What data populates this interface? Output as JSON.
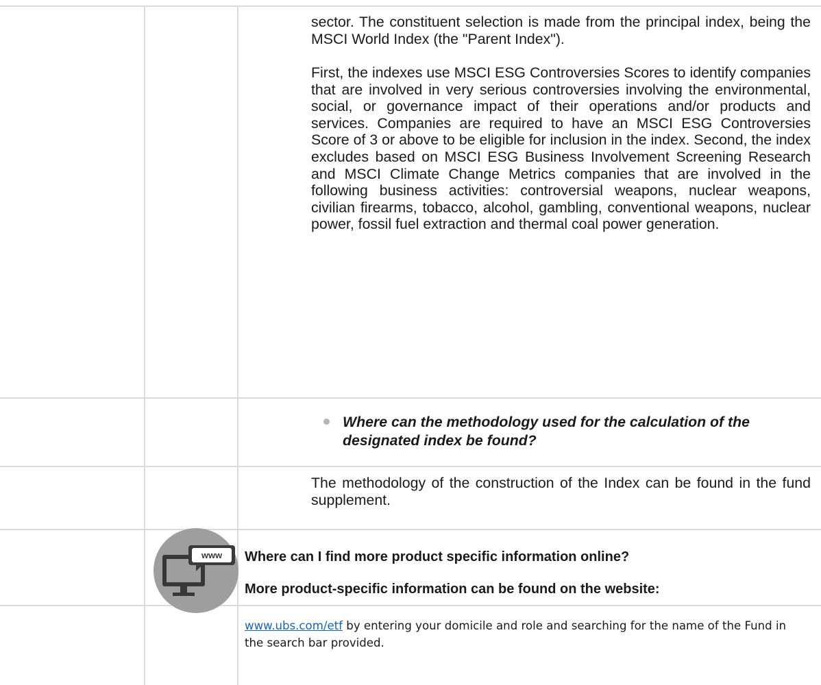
{
  "paragraph_1": "sector. The constituent selection is made from the principal index, being the MSCI World Index (the \"Parent Index\").",
  "paragraph_2": "First, the indexes use MSCI ESG Controversies Scores to identify companies that are involved in very serious controversies involving the environmental, social, or governance impact of their operations and/or products and services. Companies are required to have an MSCI ESG Controversies Score of 3 or above to be eligible for inclusion in the index. Second, the index excludes based on MSCI ESG Business Involvement Screening Research and MSCI Climate Change Metrics companies that are involved in the following business activities: controversial weapons, nuclear weapons, civilian firearms, tobacco, alcohol, gambling, conventional weapons, nuclear power, fossil fuel extraction and thermal coal power generation.",
  "methodology_question": "Where can the methodology used for the calculation of the designated index be found?",
  "methodology_answer": "The methodology of the construction of the Index can be found in the fund supplement.",
  "online_question": "Where can I find more product specific information online?",
  "online_answer": "More product-specific information can be found on the website:",
  "www_icon_label": "www",
  "website_link": "www.ubs.com/etf",
  "website_text": " by entering your domicile and role and searching for the name of the Fund in the search bar provided."
}
